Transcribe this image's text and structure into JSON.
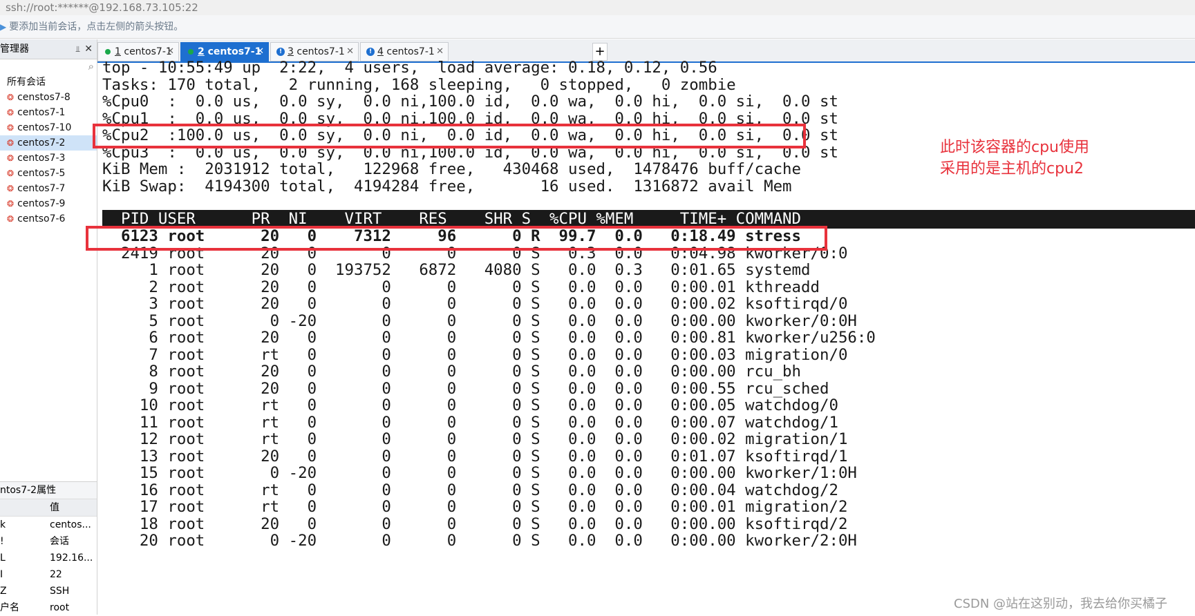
{
  "window": {
    "title": "ssh://root:******@192.168.73.105:22"
  },
  "hint": {
    "text": "要添加当前会话，点击左侧的箭头按钮。"
  },
  "sidebar": {
    "title": "管理器",
    "root_label": "所有会话",
    "sessions": [
      "censtos7-8",
      "centos7-1",
      "centos7-10",
      "centos7-2",
      "centos7-3",
      "centos7-5",
      "centos7-7",
      "centos7-9",
      "centso7-6"
    ],
    "selected": "centos7-2"
  },
  "properties": {
    "title": "ntos7-2属性",
    "header_value": "值",
    "rows": [
      {
        "key": "k",
        "value": "centos..."
      },
      {
        "key": "!",
        "value": "会话"
      },
      {
        "key": "L",
        "value": "192.16..."
      },
      {
        "key": "I",
        "value": "22"
      },
      {
        "key": "Z",
        "value": "SSH"
      },
      {
        "key": "户名",
        "value": "root"
      }
    ]
  },
  "tabs": [
    {
      "num": "1",
      "label": "centos7-1",
      "status": "connected",
      "active": false
    },
    {
      "num": "2",
      "label": "centos7-1",
      "status": "connected",
      "active": true
    },
    {
      "num": "3",
      "label": "centos7-1",
      "status": "warning",
      "active": false
    },
    {
      "num": "4",
      "label": "centos7-1",
      "status": "warning",
      "active": false
    }
  ],
  "tab_add_label": "+",
  "terminal": {
    "summary": [
      "top - 10:55:49 up  2:22,  4 users,  load average: 0.18, 0.12, 0.56",
      "Tasks: 170 total,   2 running, 168 sleeping,   0 stopped,   0 zombie",
      "%Cpu0  :  0.0 us,  0.0 sy,  0.0 ni,100.0 id,  0.0 wa,  0.0 hi,  0.0 si,  0.0 st",
      "%Cpu1  :  0.0 us,  0.0 sy,  0.0 ni,100.0 id,  0.0 wa,  0.0 hi,  0.0 si,  0.0 st",
      "%Cpu2  :100.0 us,  0.0 sy,  0.0 ni,  0.0 id,  0.0 wa,  0.0 hi,  0.0 si,  0.0 st",
      "%Cpu3  :  0.0 us,  0.0 sy,  0.0 ni,100.0 id,  0.0 wa,  0.0 hi,  0.0 si,  0.0 st",
      "KiB Mem :  2031912 total,   122968 free,   430468 used,  1478476 buff/cache",
      "KiB Swap:  4194300 total,  4194284 free,       16 used.  1316872 avail Mem"
    ],
    "header": "  PID USER      PR  NI    VIRT    RES    SHR S  %CPU %MEM     TIME+ COMMAND",
    "processes": [
      "  6123 root      20   0    7312     96      0 R  99.7  0.0   0:18.49 stress",
      "  2419 root      20   0       0      0      0 S   0.3  0.0   0:04.98 kworker/0:0",
      "     1 root      20   0  193752   6872   4080 S   0.0  0.3   0:01.65 systemd",
      "     2 root      20   0       0      0      0 S   0.0  0.0   0:00.01 kthreadd",
      "     3 root      20   0       0      0      0 S   0.0  0.0   0:00.02 ksoftirqd/0",
      "     5 root       0 -20       0      0      0 S   0.0  0.0   0:00.00 kworker/0:0H",
      "     6 root      20   0       0      0      0 S   0.0  0.0   0:00.81 kworker/u256:0",
      "     7 root      rt   0       0      0      0 S   0.0  0.0   0:00.03 migration/0",
      "     8 root      20   0       0      0      0 S   0.0  0.0   0:00.00 rcu_bh",
      "     9 root      20   0       0      0      0 S   0.0  0.0   0:00.55 rcu_sched",
      "    10 root      rt   0       0      0      0 S   0.0  0.0   0:00.05 watchdog/0",
      "    11 root      rt   0       0      0      0 S   0.0  0.0   0:00.07 watchdog/1",
      "    12 root      rt   0       0      0      0 S   0.0  0.0   0:00.02 migration/1",
      "    13 root      20   0       0      0      0 S   0.0  0.0   0:01.07 ksoftirqd/1",
      "    15 root       0 -20       0      0      0 S   0.0  0.0   0:00.00 kworker/1:0H",
      "    16 root      rt   0       0      0      0 S   0.0  0.0   0:00.04 watchdog/2",
      "    17 root      rt   0       0      0      0 S   0.0  0.0   0:00.01 migration/2",
      "    18 root      20   0       0      0      0 S   0.0  0.0   0:00.00 ksoftirqd/2",
      "    20 root       0 -20       0      0      0 S   0.0  0.0   0:00.00 kworker/2:0H"
    ]
  },
  "annotation": {
    "line1": "此时该容器的cpu使用",
    "line2": "采用的是主机的cpu2"
  },
  "watermark": "CSDN @站在这别动，我去给你买橘子",
  "colors": {
    "accent": "#1e6fd0",
    "highlight": "#e8323c",
    "header_bg": "#1a1a1a"
  }
}
